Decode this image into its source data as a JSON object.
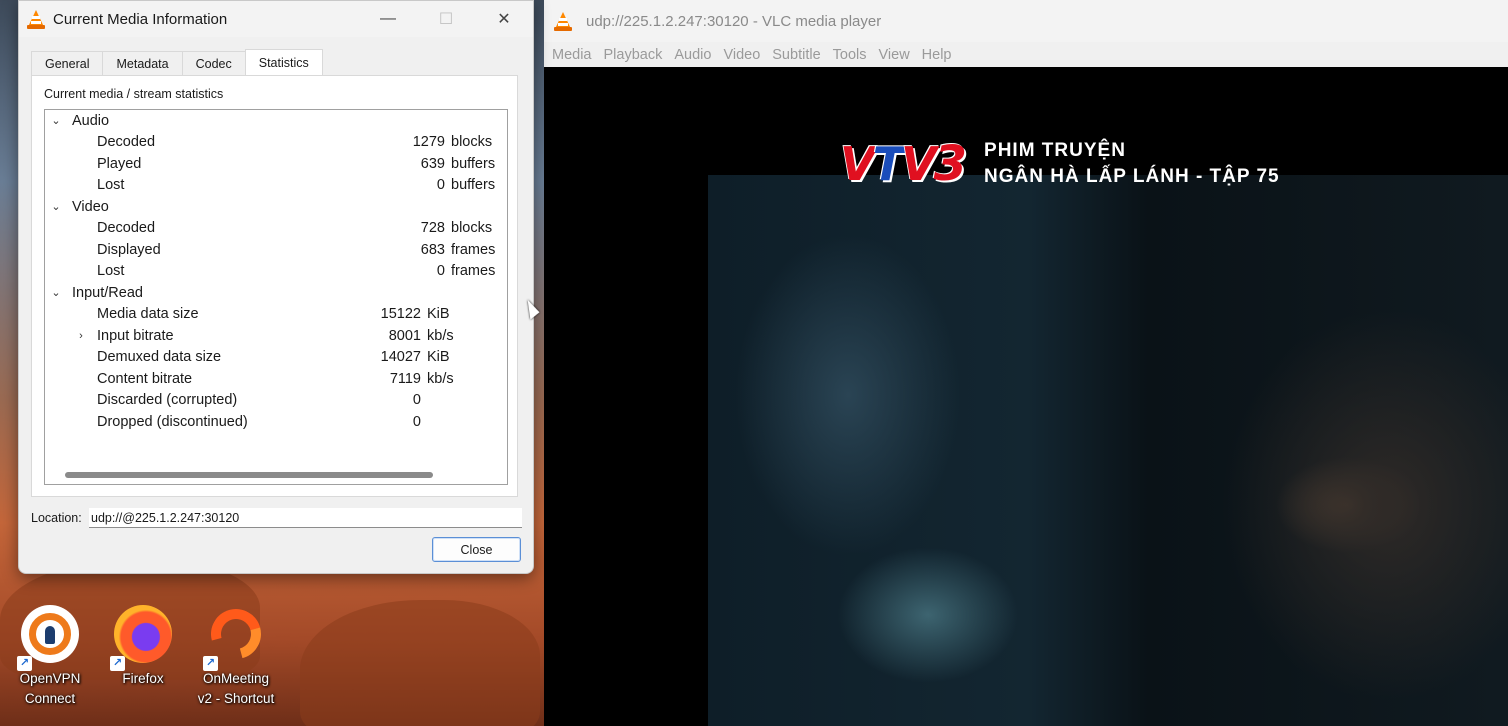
{
  "media_info": {
    "title": "Current Media Information",
    "controls": {
      "minimize": "—",
      "maximize": "☐",
      "close": "✕"
    },
    "tabs": [
      "General",
      "Metadata",
      "Codec",
      "Statistics"
    ],
    "active_tab": "Statistics",
    "section_heading": "Current media / stream statistics",
    "audio": {
      "label": "Audio",
      "decoded": {
        "label": "Decoded",
        "value": "1279",
        "unit": "blocks"
      },
      "played": {
        "label": "Played",
        "value": "639",
        "unit": "buffers"
      },
      "lost": {
        "label": "Lost",
        "value": "0",
        "unit": "buffers"
      }
    },
    "video": {
      "label": "Video",
      "decoded": {
        "label": "Decoded",
        "value": "728",
        "unit": "blocks"
      },
      "displayed": {
        "label": "Displayed",
        "value": "683",
        "unit": "frames"
      },
      "lost": {
        "label": "Lost",
        "value": "0",
        "unit": "frames"
      }
    },
    "input": {
      "label": "Input/Read",
      "media_data_size": {
        "label": "Media data size",
        "value": "15122",
        "unit": "KiB"
      },
      "input_bitrate": {
        "label": "Input bitrate",
        "value": "8001",
        "unit": "kb/s"
      },
      "demuxed_data_size": {
        "label": "Demuxed data size",
        "value": "14027",
        "unit": "KiB"
      },
      "content_bitrate": {
        "label": "Content bitrate",
        "value": "7119",
        "unit": "kb/s"
      },
      "discarded": {
        "label": "Discarded (corrupted)",
        "value": "0",
        "unit": ""
      },
      "dropped": {
        "label": "Dropped (discontinued)",
        "value": "0",
        "unit": ""
      }
    },
    "location_label": "Location:",
    "location_value": "udp://@225.1.2.247:30120",
    "close_label": "Close"
  },
  "vlc": {
    "title": "udp://225.1.2.247:30120 - VLC media player",
    "menu": [
      "Media",
      "Playback",
      "Audio",
      "Video",
      "Subtitle",
      "Tools",
      "View",
      "Help"
    ],
    "overlay": {
      "logo_parts": [
        "V",
        "T",
        "V",
        "3"
      ],
      "line1": "PHIM TRUYỆN",
      "line2": "NGÂN HÀ LẤP LÁNH - TẬP 75"
    }
  },
  "desktop": {
    "icons": [
      {
        "name": "OpenVPN Connect",
        "line1": "OpenVPN",
        "line2": "Connect"
      },
      {
        "name": "Firefox",
        "line1": "Firefox",
        "line2": ""
      },
      {
        "name": "OnMeeting v2 - Shortcut",
        "line1": "OnMeeting",
        "line2": "v2 - Shortcut"
      }
    ],
    "shortcut_glyph": "↗"
  },
  "colors": {
    "vlc_orange": "#ff8800",
    "vtv_red": "#e01020",
    "vtv_blue": "#1a4dbb",
    "close_button_border": "#5b8fd6"
  }
}
